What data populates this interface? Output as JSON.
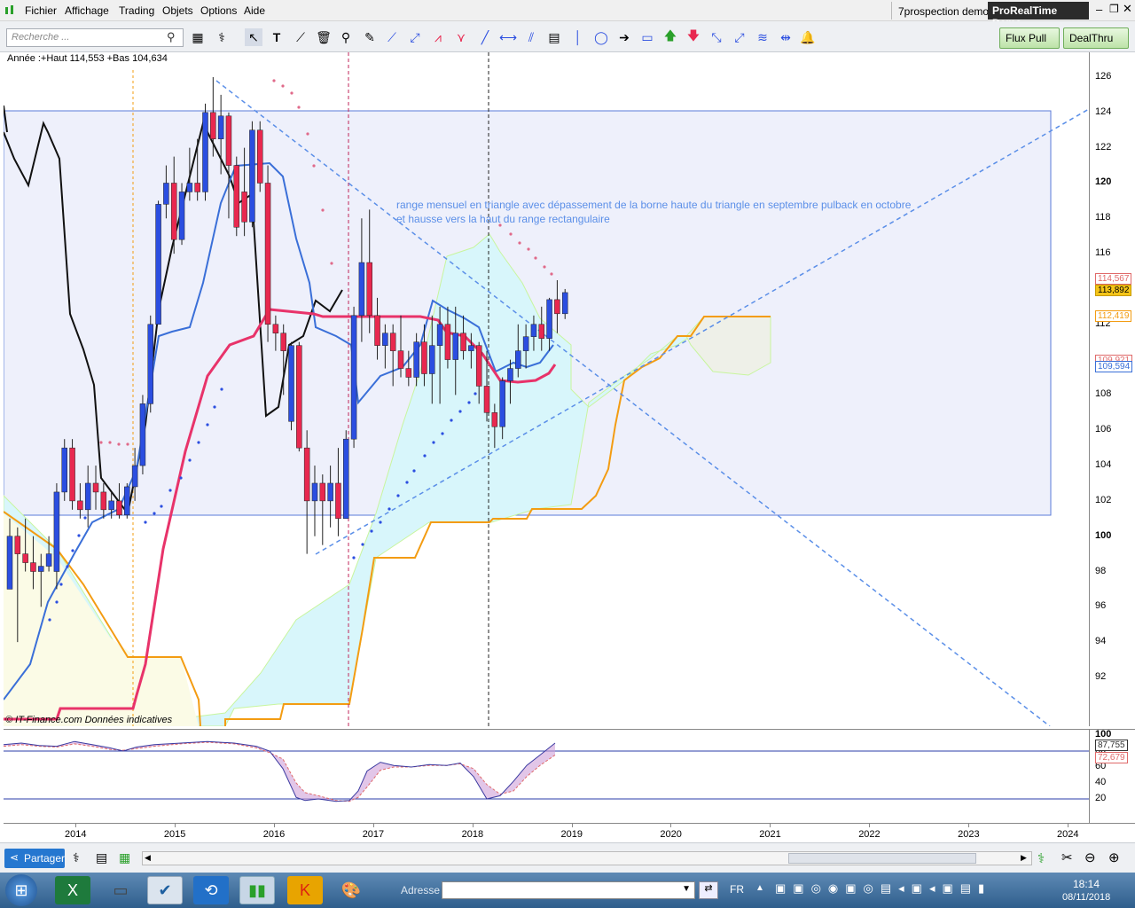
{
  "menu": [
    "Fichier",
    "Affichage",
    "Trading",
    "Objets",
    "Options",
    "Aide"
  ],
  "account": "7prospection demo",
  "app_badge": "ProRealTime Demo",
  "search_placeholder": "Recherche ...",
  "buttons": {
    "flux": "Flux Pull",
    "dealthru": "DealThru",
    "partager": "Partager"
  },
  "chart_info": "Année :+Haut 114,553 +Bas 104,634",
  "source_note": "© IT-Finance.com  Données indicatives",
  "annotation": {
    "line1": "range mensuel en triangle avec dépassement de la borne haute du triangle en septembre pulback en octobre",
    "line2": "et hausse vers la haut du range rectangulaire"
  },
  "price_ticks": [
    "126",
    "124",
    "122",
    "120",
    "118",
    "116",
    "114",
    "112",
    "110",
    "108",
    "106",
    "104",
    "102",
    "100",
    "98",
    "96",
    "94",
    "92"
  ],
  "price_labels": [
    {
      "text": "114,567",
      "color": "#e06a6a"
    },
    {
      "text": "113,892",
      "color": "#c79b00"
    },
    {
      "text": "112,419",
      "color": "#f39c12"
    },
    {
      "text": "109,921",
      "color": "#e06a6a"
    },
    {
      "text": "109,594",
      "color": "#3a6fd8"
    }
  ],
  "osc_ticks": [
    "100",
    "80",
    "60",
    "40",
    "20"
  ],
  "osc_labels": [
    {
      "text": "87,755",
      "color": "#333"
    },
    {
      "text": "72,679",
      "color": "#e06a6a"
    }
  ],
  "years": [
    "2014",
    "2015",
    "2016",
    "2017",
    "2018",
    "2019",
    "2020",
    "2021",
    "2022",
    "2023",
    "2024"
  ],
  "taskbar": {
    "adresse": "Adresse",
    "lang": "FR",
    "time": "18:14",
    "date": "08/11/2018"
  },
  "colors": {
    "bull": "#2b4ee0",
    "bear": "#e8284f",
    "kijun": "#e8336a",
    "tenkan": "#3a6fd8",
    "cloud": "#d8f6fb",
    "chikou": "#111111",
    "senkou_b": "#f39c12",
    "box": "#eef0fb"
  },
  "chart_data": [
    {
      "type": "candlestick",
      "title": "",
      "timeframe": "monthly",
      "x_axis": [
        "2014",
        "2015",
        "2016",
        "2017",
        "2018",
        "2019",
        "2020",
        "2021",
        "2022",
        "2023",
        "2024"
      ],
      "ylim": [
        90,
        127
      ],
      "yearly_high": 114.553,
      "yearly_low": 104.634,
      "candles": [
        {
          "o": 97,
          "h": 101,
          "l": 97,
          "c": 100
        },
        {
          "o": 100,
          "h": 100.5,
          "l": 94,
          "c": 99
        },
        {
          "o": 99,
          "h": 101,
          "l": 98,
          "c": 98.5
        },
        {
          "o": 98.5,
          "h": 100,
          "l": 97,
          "c": 98
        },
        {
          "o": 98,
          "h": 99,
          "l": 96,
          "c": 98.3
        },
        {
          "o": 98.3,
          "h": 100,
          "l": 98,
          "c": 99
        },
        {
          "o": 98,
          "h": 103,
          "l": 97,
          "c": 102.5
        },
        {
          "o": 102.5,
          "h": 105.5,
          "l": 102,
          "c": 105
        },
        {
          "o": 105,
          "h": 105.5,
          "l": 101.5,
          "c": 102
        },
        {
          "o": 102,
          "h": 103,
          "l": 101,
          "c": 101.5
        },
        {
          "o": 101.5,
          "h": 104,
          "l": 100.5,
          "c": 103
        },
        {
          "o": 103,
          "h": 104,
          "l": 101.5,
          "c": 102.5
        },
        {
          "o": 102.5,
          "h": 103,
          "l": 101,
          "c": 101.5
        },
        {
          "o": 101.5,
          "h": 102.5,
          "l": 101,
          "c": 102
        },
        {
          "o": 102,
          "h": 103,
          "l": 101,
          "c": 101.2
        },
        {
          "o": 101.2,
          "h": 103,
          "l": 101,
          "c": 102.8
        },
        {
          "o": 102.8,
          "h": 105,
          "l": 102,
          "c": 104
        },
        {
          "o": 104,
          "h": 108,
          "l": 103.5,
          "c": 107.5
        },
        {
          "o": 107.5,
          "h": 112.5,
          "l": 107,
          "c": 112
        },
        {
          "o": 112,
          "h": 119,
          "l": 112,
          "c": 118.8
        },
        {
          "o": 118.8,
          "h": 121,
          "l": 118,
          "c": 120
        },
        {
          "o": 120,
          "h": 121.5,
          "l": 116,
          "c": 116.8
        },
        {
          "o": 116.8,
          "h": 120,
          "l": 116.5,
          "c": 119.5
        },
        {
          "o": 119.5,
          "h": 122,
          "l": 119,
          "c": 120
        },
        {
          "o": 120,
          "h": 122.5,
          "l": 119,
          "c": 119.5
        },
        {
          "o": 119.5,
          "h": 124.5,
          "l": 119,
          "c": 124
        },
        {
          "o": 124,
          "h": 126,
          "l": 121.5,
          "c": 122.5
        },
        {
          "o": 122.5,
          "h": 125,
          "l": 120.5,
          "c": 123.8
        },
        {
          "o": 123.8,
          "h": 124,
          "l": 118,
          "c": 121
        },
        {
          "o": 121,
          "h": 121.5,
          "l": 117,
          "c": 117.5
        },
        {
          "o": 119.5,
          "h": 122,
          "l": 117,
          "c": 117.8
        },
        {
          "o": 117.8,
          "h": 123.5,
          "l": 117.5,
          "c": 123
        },
        {
          "o": 123,
          "h": 123.5,
          "l": 119.5,
          "c": 120
        },
        {
          "o": 120,
          "h": 121,
          "l": 111,
          "c": 112
        },
        {
          "o": 112,
          "h": 112.5,
          "l": 110.5,
          "c": 111.5
        },
        {
          "o": 111.5,
          "h": 112,
          "l": 108,
          "c": 110.5
        },
        {
          "o": 106.5,
          "h": 111,
          "l": 106,
          "c": 110.8
        },
        {
          "o": 110.8,
          "h": 111,
          "l": 104.8,
          "c": 105
        },
        {
          "o": 105,
          "h": 106,
          "l": 99,
          "c": 102
        },
        {
          "o": 102,
          "h": 104,
          "l": 100,
          "c": 103
        },
        {
          "o": 103,
          "h": 103.5,
          "l": 99.5,
          "c": 102
        },
        {
          "o": 102,
          "h": 104,
          "l": 100.5,
          "c": 103
        },
        {
          "o": 103,
          "h": 105,
          "l": 100,
          "c": 101
        },
        {
          "o": 101,
          "h": 106,
          "l": 101,
          "c": 105.5
        },
        {
          "o": 105.5,
          "h": 113,
          "l": 105,
          "c": 112.5
        },
        {
          "o": 112.5,
          "h": 118,
          "l": 111,
          "c": 115.5
        },
        {
          "o": 115.5,
          "h": 118.5,
          "l": 111.5,
          "c": 112.5
        },
        {
          "o": 112.5,
          "h": 113.5,
          "l": 110,
          "c": 110.8
        },
        {
          "o": 110.8,
          "h": 112,
          "l": 109.5,
          "c": 111.5
        },
        {
          "o": 111.5,
          "h": 112,
          "l": 108.5,
          "c": 110.5
        },
        {
          "o": 110.5,
          "h": 112.5,
          "l": 109,
          "c": 109.5
        },
        {
          "o": 109.5,
          "h": 110.5,
          "l": 108.5,
          "c": 109
        },
        {
          "o": 109,
          "h": 111.5,
          "l": 108.5,
          "c": 111
        },
        {
          "o": 111,
          "h": 112,
          "l": 108.5,
          "c": 109.2
        },
        {
          "o": 109.2,
          "h": 112.5,
          "l": 107.5,
          "c": 110.8
        },
        {
          "o": 110.8,
          "h": 113,
          "l": 107.5,
          "c": 112
        },
        {
          "o": 112,
          "h": 113,
          "l": 109.5,
          "c": 110
        },
        {
          "o": 110,
          "h": 113,
          "l": 108,
          "c": 111.5
        },
        {
          "o": 111.5,
          "h": 112.5,
          "l": 110,
          "c": 110.5
        },
        {
          "o": 110.5,
          "h": 111.5,
          "l": 109.5,
          "c": 110.8
        },
        {
          "o": 110.8,
          "h": 111,
          "l": 107.5,
          "c": 108.5
        },
        {
          "o": 108.5,
          "h": 110.5,
          "l": 106.5,
          "c": 107
        },
        {
          "o": 107,
          "h": 107.5,
          "l": 105,
          "c": 106.2
        },
        {
          "o": 106.2,
          "h": 109,
          "l": 105.5,
          "c": 108.8
        },
        {
          "o": 108.8,
          "h": 110,
          "l": 107.5,
          "c": 109.5
        },
        {
          "o": 109.5,
          "h": 112,
          "l": 109,
          "c": 110.5
        },
        {
          "o": 110.5,
          "h": 112,
          "l": 109.5,
          "c": 111.3
        },
        {
          "o": 111.3,
          "h": 112.5,
          "l": 110.5,
          "c": 112
        },
        {
          "o": 112,
          "h": 113,
          "l": 110.5,
          "c": 111.2
        },
        {
          "o": 111.2,
          "h": 113.5,
          "l": 110.5,
          "c": 113.4
        },
        {
          "o": 113.4,
          "h": 114.5,
          "l": 111.5,
          "c": 112.6
        },
        {
          "o": 112.6,
          "h": 114,
          "l": 112.3,
          "c": 113.8
        }
      ]
    },
    {
      "type": "line",
      "title": "",
      "ylim": [
        0,
        100
      ],
      "x_axis": [
        "2014",
        "2015",
        "2016",
        "2017",
        "2018",
        "2019"
      ],
      "reference_lines": [
        20,
        80
      ],
      "last_values": [
        87.755,
        72.679
      ]
    }
  ]
}
